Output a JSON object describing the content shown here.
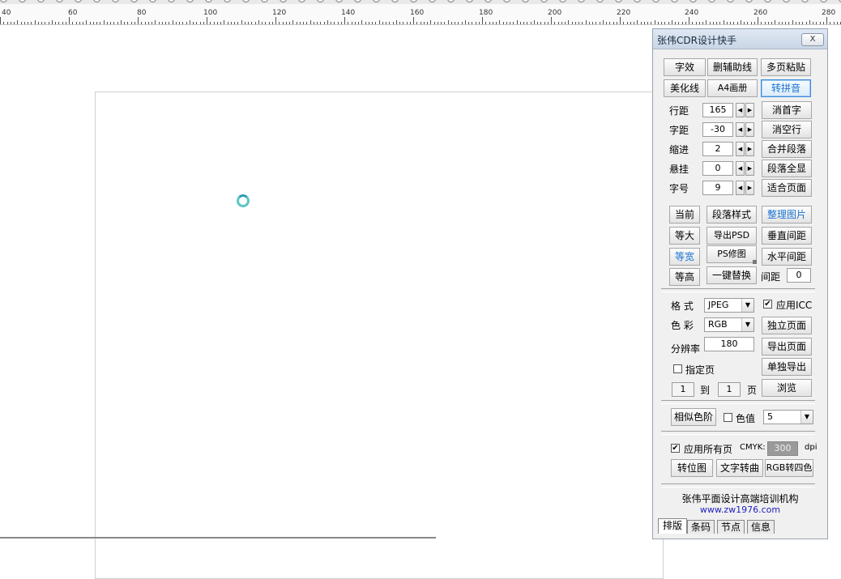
{
  "ruler": {
    "labels": [
      "40",
      "60",
      "80",
      "100",
      "120",
      "140",
      "160",
      "180",
      "200",
      "220",
      "240",
      "260",
      "280"
    ]
  },
  "panel": {
    "title": "张伟CDR设计快手",
    "close": "X",
    "row1": [
      "字效",
      "删辅助线",
      "多页粘贴"
    ],
    "row2": [
      "美化线",
      "A4画册",
      "转拼音"
    ],
    "params": [
      {
        "label": "行距",
        "value": "165",
        "action": "消首字"
      },
      {
        "label": "字距",
        "value": "-30",
        "action": "消空行"
      },
      {
        "label": "缩进",
        "value": "2",
        "action": "合并段落"
      },
      {
        "label": "悬挂",
        "value": "0",
        "action": "段落全显"
      },
      {
        "label": "字号",
        "value": "9",
        "action": "适合页面"
      }
    ],
    "grid": [
      [
        "当前",
        "段落样式",
        "整理图片"
      ],
      [
        "等大",
        "导出PSD",
        "垂直间距"
      ],
      [
        "等宽",
        "PS修图",
        "水平间距"
      ],
      [
        "等高",
        "一键替换"
      ]
    ],
    "spacing_label": "间距",
    "spacing_value": "0",
    "format_label": "格  式",
    "format_value": "JPEG",
    "apply_icc": "应用ICC",
    "color_label": "色  彩",
    "color_value": "RGB",
    "independent_page": "独立页面",
    "resolution_label": "分辨率",
    "resolution_value": "180",
    "export_page": "导出页面",
    "specify_page": "指定页",
    "export_single": "单独导出",
    "page_from": "1",
    "page_to_label": "到",
    "page_to": "1",
    "page_unit": "页",
    "browse": "浏览",
    "similar_level": "相似色阶",
    "color_value_label": "色值",
    "color_value_sel": "5",
    "apply_all_pages": "应用所有页",
    "cmyk_label": "CMYK:",
    "cmyk_value": "300",
    "dpi": "dpi",
    "convert_bitmap": "转位图",
    "text_to_curve": "文字转曲",
    "rgb_to_cmyk": "RGB转四色",
    "footer_org": "张伟平面设计高端培训机构",
    "footer_url": "www.zw1976.com",
    "tabs": [
      "排版",
      "条码",
      "节点",
      "信息"
    ]
  },
  "colors": {
    "accent_blue": "#1c74d1",
    "url_blue": "#2020c0"
  }
}
